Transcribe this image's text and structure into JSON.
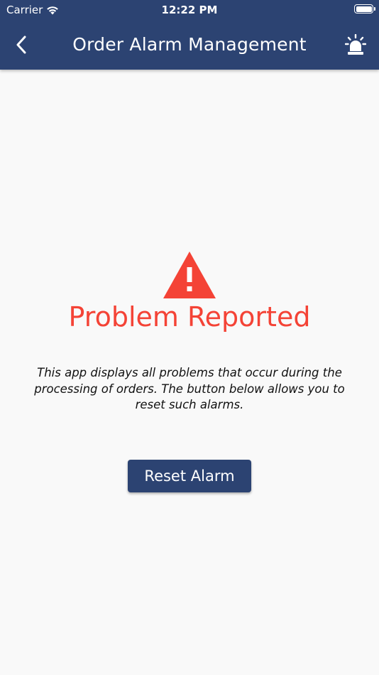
{
  "status_bar": {
    "carrier": "Carrier",
    "time": "12:22 PM",
    "icons": [
      "wifi-icon",
      "battery-icon"
    ]
  },
  "nav_bar": {
    "back_icon": "chevron-left-icon",
    "title": "Order Alarm Management",
    "action_icon": "siren-alarm-icon"
  },
  "main": {
    "warning_icon": "warning-triangle-icon",
    "title": "Problem Reported",
    "description": "This app displays all problems that occur during the processing of orders. The button below allows you to reset such alarms.",
    "reset_button_label": "Reset Alarm"
  },
  "colors": {
    "primary": "#2c4372",
    "error": "#f44336",
    "background": "#f9f9f9",
    "text": "#111111"
  }
}
